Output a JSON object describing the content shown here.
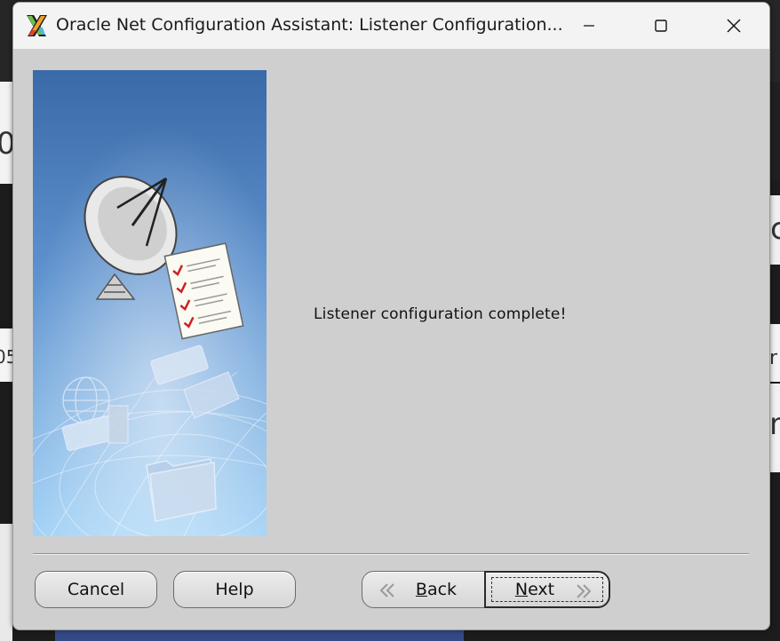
{
  "window": {
    "title": "Oracle Net Configuration Assistant: Listener Configuration...",
    "controls": [
      "minimize",
      "maximize",
      "close"
    ]
  },
  "content": {
    "message": "Listener configuration complete!"
  },
  "buttons": {
    "cancel": "Cancel",
    "help": "Help",
    "back_mnemonic": "B",
    "back_rest": "ack",
    "next_mnemonic": "N",
    "next_rest": "ext"
  },
  "background_fragments": {
    "left_1": "0",
    "left_2": "05",
    "right_1": "c",
    "right_2": "n",
    "right_3": "r"
  },
  "icons": {
    "app": "oracle-x-icon",
    "minimize": "minimize-icon",
    "maximize": "maximize-icon",
    "close": "close-icon",
    "back": "double-chevron-left-icon",
    "next": "double-chevron-right-icon"
  },
  "colors": {
    "dialog_bg": "#cfcfcf",
    "titlebar_bg": "#f3f3f3",
    "panel_blue_top": "#3c6eae",
    "panel_blue_bottom": "#9fd0f6"
  }
}
